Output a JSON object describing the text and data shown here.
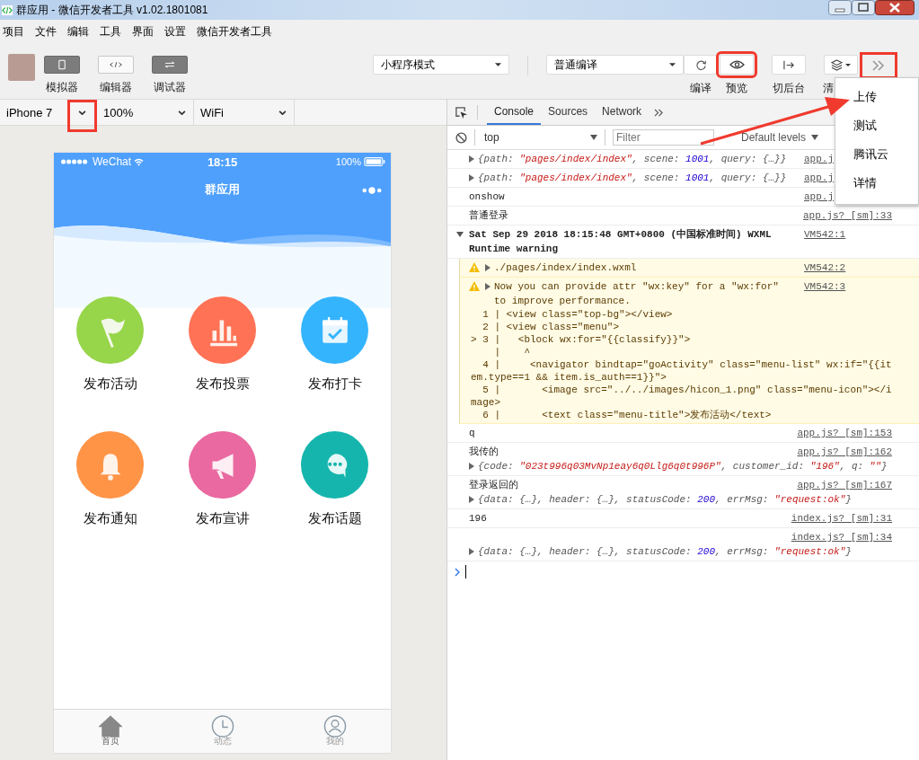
{
  "window": {
    "title": "群应用 - 微信开发者工具 v1.02.1801081"
  },
  "menu": [
    "项目",
    "文件",
    "编辑",
    "工具",
    "界面",
    "设置",
    "微信开发者工具"
  ],
  "toolbar": {
    "views": [
      {
        "label": "模拟器",
        "kind": "phone",
        "on": true
      },
      {
        "label": "编辑器",
        "kind": "code",
        "on": false
      },
      {
        "label": "调试器",
        "kind": "debug",
        "on": true
      }
    ],
    "mode_select": {
      "value": "小程序模式"
    },
    "compile_select": {
      "value": "普通编译"
    },
    "actions": [
      {
        "kind": "refresh",
        "label": "编译",
        "highlighted": false
      },
      {
        "kind": "eye",
        "label": "预览",
        "highlighted": true
      },
      {
        "kind": "background",
        "label": "切后台",
        "highlighted": false
      },
      {
        "kind": "layers",
        "label": "清",
        "highlighted": false
      }
    ],
    "more_button": {
      "highlighted": true
    }
  },
  "more_menu": [
    "上传",
    "测试",
    "腾讯云",
    "详情"
  ],
  "device_bar": [
    {
      "value": "iPhone 7",
      "highlighted": true
    },
    {
      "value": "100%"
    },
    {
      "value": "WiFi"
    }
  ],
  "phone": {
    "status": {
      "carrier": "WeChat",
      "time": "18:15",
      "battery": "100%"
    },
    "title": "群应用",
    "grid": [
      {
        "label": "发布活动",
        "kind": "flag",
        "color": "#97d54a"
      },
      {
        "label": "发布投票",
        "kind": "chart",
        "color": "#ff7255"
      },
      {
        "label": "发布打卡",
        "kind": "calendar",
        "color": "#35b4fe"
      },
      {
        "label": "发布通知",
        "kind": "bell",
        "color": "#ff9447"
      },
      {
        "label": "发布宣讲",
        "kind": "megaphone",
        "color": "#e969a0"
      },
      {
        "label": "发布话题",
        "kind": "chat",
        "color": "#15b5ad"
      }
    ],
    "tabbar": [
      {
        "label": "首页",
        "kind": "home",
        "selected": true
      },
      {
        "label": "动态",
        "kind": "clock",
        "selected": false
      },
      {
        "label": "我的",
        "kind": "user",
        "selected": false
      }
    ]
  },
  "devtools": {
    "tabs": [
      {
        "label": "Console",
        "selected": true
      },
      {
        "label": "Sources",
        "selected": false
      },
      {
        "label": "Network",
        "selected": false
      }
    ],
    "context": "top",
    "filter_placeholder": "Filter",
    "levels": "Default levels",
    "entries": [
      {
        "kind": "object",
        "source": "app.j",
        "parts": [
          {
            "t": "{path: ",
            "kind": "plain"
          },
          {
            "t": "\"pages/index/index\"",
            "kind": "string"
          },
          {
            "t": ", scene: ",
            "kind": "plain"
          },
          {
            "t": "1001",
            "kind": "number"
          },
          {
            "t": ", query: {…}}",
            "kind": "plain"
          }
        ]
      },
      {
        "kind": "object",
        "source": "app.j",
        "parts": [
          {
            "t": "{path: ",
            "kind": "plain"
          },
          {
            "t": "\"pages/index/index\"",
            "kind": "string"
          },
          {
            "t": ", scene: ",
            "kind": "plain"
          },
          {
            "t": "1001",
            "kind": "number"
          },
          {
            "t": ", query: {…}}",
            "kind": "plain"
          }
        ]
      },
      {
        "kind": "text",
        "message": "onshow",
        "source": "app.j"
      },
      {
        "kind": "text",
        "message": "普通登录",
        "source": "app.js? [sm]:33"
      },
      {
        "kind": "group",
        "expanded": true,
        "message": "Sat Sep 29 2018 18:15:48 GMT+0800 (中国标准时间) WXML Runtime warning",
        "source": "VM542:1"
      },
      {
        "kind": "warning",
        "message": "./pages/index/index.wxml",
        "source": "VM542:2"
      },
      {
        "kind": "warning",
        "message": "Now you can provide attr \"wx:key\" for a \"wx:for\" to improve performance.",
        "source": "VM542:3",
        "code": [
          "  1 | <view class=\"top-bg\"></view>",
          "  2 | <view class=\"menu\">",
          "> 3 |   <block wx:for=\"{{classify}}\">",
          "    |    ^",
          "  4 |     <navigator bindtap=\"goActivity\" class=\"menu-list\" wx:if=\"{{item.type==1 && item.is_auth==1}}\">",
          "  5 |       <image src=\"../../images/hicon_1.png\" class=\"menu-icon\"></image>",
          "  6 |       <text class=\"menu-title\">发布活动</text>"
        ]
      },
      {
        "kind": "text",
        "message": "q",
        "source": "app.js? [sm]:153"
      },
      {
        "kind": "text",
        "message": "我传的",
        "source": "app.js? [sm]:162",
        "parts": [
          {
            "t": "{code: ",
            "kind": "plain"
          },
          {
            "t": "\"023t996q03MvNp1eay6q0Llg6q0t996P\"",
            "kind": "string"
          },
          {
            "t": ", customer_id: ",
            "kind": "plain"
          },
          {
            "t": "\"196\"",
            "kind": "string"
          },
          {
            "t": ", q: ",
            "kind": "plain"
          },
          {
            "t": "\"\"",
            "kind": "string"
          },
          {
            "t": "}",
            "kind": "plain"
          }
        ]
      },
      {
        "kind": "text",
        "message": "登录返回的",
        "source": "app.js? [sm]:167",
        "parts": [
          {
            "t": "{data: {…}, header: {…}, statusCode: ",
            "kind": "plain"
          },
          {
            "t": "200",
            "kind": "number"
          },
          {
            "t": ", errMsg: ",
            "kind": "plain"
          },
          {
            "t": "\"request:ok\"",
            "kind": "string"
          },
          {
            "t": "}",
            "kind": "plain"
          }
        ]
      },
      {
        "kind": "text",
        "message": "196",
        "source": "index.js? [sm]:31"
      },
      {
        "kind": "object_below",
        "source": "index.js? [sm]:34",
        "parts": [
          {
            "t": "{data: {…}, header: {…}, statusCode: ",
            "kind": "plain"
          },
          {
            "t": "200",
            "kind": "number"
          },
          {
            "t": ", errMsg: ",
            "kind": "plain"
          },
          {
            "t": "\"request:ok\"",
            "kind": "string"
          },
          {
            "t": "}",
            "kind": "plain"
          }
        ]
      }
    ]
  }
}
